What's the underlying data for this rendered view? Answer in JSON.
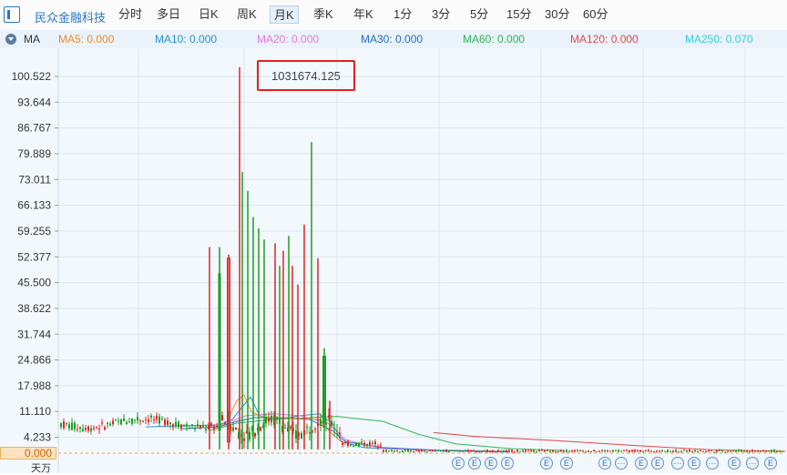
{
  "toolbar": {
    "stock_name": "民众金融科技",
    "tabs": [
      "分时",
      "多日",
      "日K",
      "周K",
      "月K",
      "季K",
      "年K",
      "1分",
      "3分",
      "5分",
      "15分",
      "30分",
      "60分"
    ],
    "active_tab": "月K"
  },
  "ma_bar": {
    "label": "MA",
    "items": [
      {
        "text": "MA5: 0.000",
        "color": "#f08a24"
      },
      {
        "text": "MA10: 0.000",
        "color": "#2a8fd6"
      },
      {
        "text": "MA20: 0.000",
        "color": "#e07bd8"
      },
      {
        "text": "MA30: 0.000",
        "color": "#1e6fc4"
      },
      {
        "text": "MA60: 0.000",
        "color": "#2fb452"
      },
      {
        "text": "MA120: 0.000",
        "color": "#e04848"
      },
      {
        "text": "MA250: 0.070",
        "color": "#30d0d6"
      }
    ]
  },
  "tooltip": {
    "value": "1031674.125"
  },
  "current_price": "0.000",
  "unit_label": "天万",
  "event_marker": "E",
  "more_marker": "···",
  "colors": {
    "up": "#e02424",
    "down": "#1e9e1e",
    "grid": "#d9e6f2",
    "axis": "#c8d8e8"
  },
  "chart_data": {
    "type": "candlestick",
    "y_ticks": [
      "100.522",
      "93.644",
      "86.767",
      "79.889",
      "73.011",
      "66.133",
      "59.255",
      "52.377",
      "45.500",
      "38.622",
      "31.744",
      "24.866",
      "17.988",
      "11.110",
      "4.233",
      "0.000"
    ],
    "ylim": [
      0,
      103
    ],
    "spikes": [
      {
        "color": "up",
        "high": 55,
        "low": 1
      },
      {
        "color": "down",
        "high": 55,
        "low": 1
      },
      {
        "color": "up",
        "high": 53,
        "low": 1
      },
      {
        "color": "up",
        "high": 103,
        "low": 1
      },
      {
        "color": "down",
        "high": 75,
        "low": 1
      },
      {
        "color": "down",
        "high": 70,
        "low": 1
      },
      {
        "color": "down",
        "high": 63,
        "low": 1
      },
      {
        "color": "down",
        "high": 60,
        "low": 1
      },
      {
        "color": "down",
        "high": 57,
        "low": 1
      },
      {
        "color": "up",
        "high": 56,
        "low": 1
      },
      {
        "color": "down",
        "high": 50,
        "low": 1
      },
      {
        "color": "up",
        "high": 54,
        "low": 1
      },
      {
        "color": "down",
        "high": 58,
        "low": 1
      },
      {
        "color": "up",
        "high": 50,
        "low": 1
      },
      {
        "color": "up",
        "high": 45,
        "low": 1
      },
      {
        "color": "up",
        "high": 61,
        "low": 1
      },
      {
        "color": "down",
        "high": 83,
        "low": 1
      },
      {
        "color": "up",
        "high": 52,
        "low": 1
      },
      {
        "color": "down",
        "high": 28,
        "low": 1
      },
      {
        "color": "up",
        "high": 14,
        "low": 1
      }
    ]
  }
}
